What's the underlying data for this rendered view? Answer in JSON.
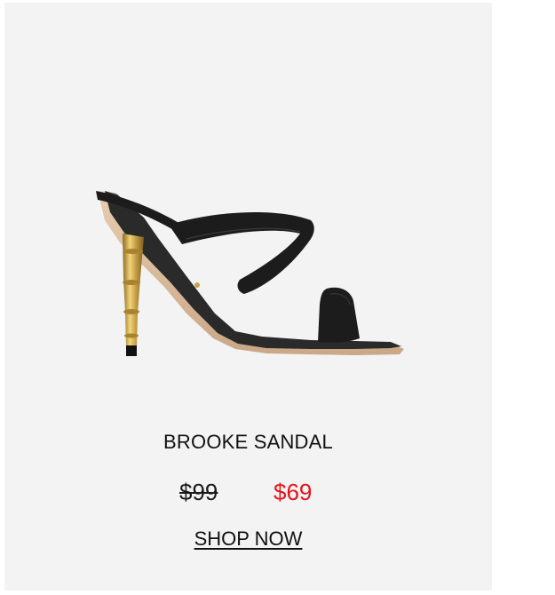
{
  "product": {
    "name": "BROOKE SANDAL",
    "price_original": "$99",
    "price_sale": "$69",
    "cta_label": "SHOP NOW"
  },
  "colors": {
    "card_background": "#f3f3f3",
    "sale_price": "#e4141b",
    "text": "#111111",
    "heel_gold": "#c9a24a",
    "strap_black": "#1c1c1c"
  },
  "image": {
    "subject": "sandal-image"
  }
}
